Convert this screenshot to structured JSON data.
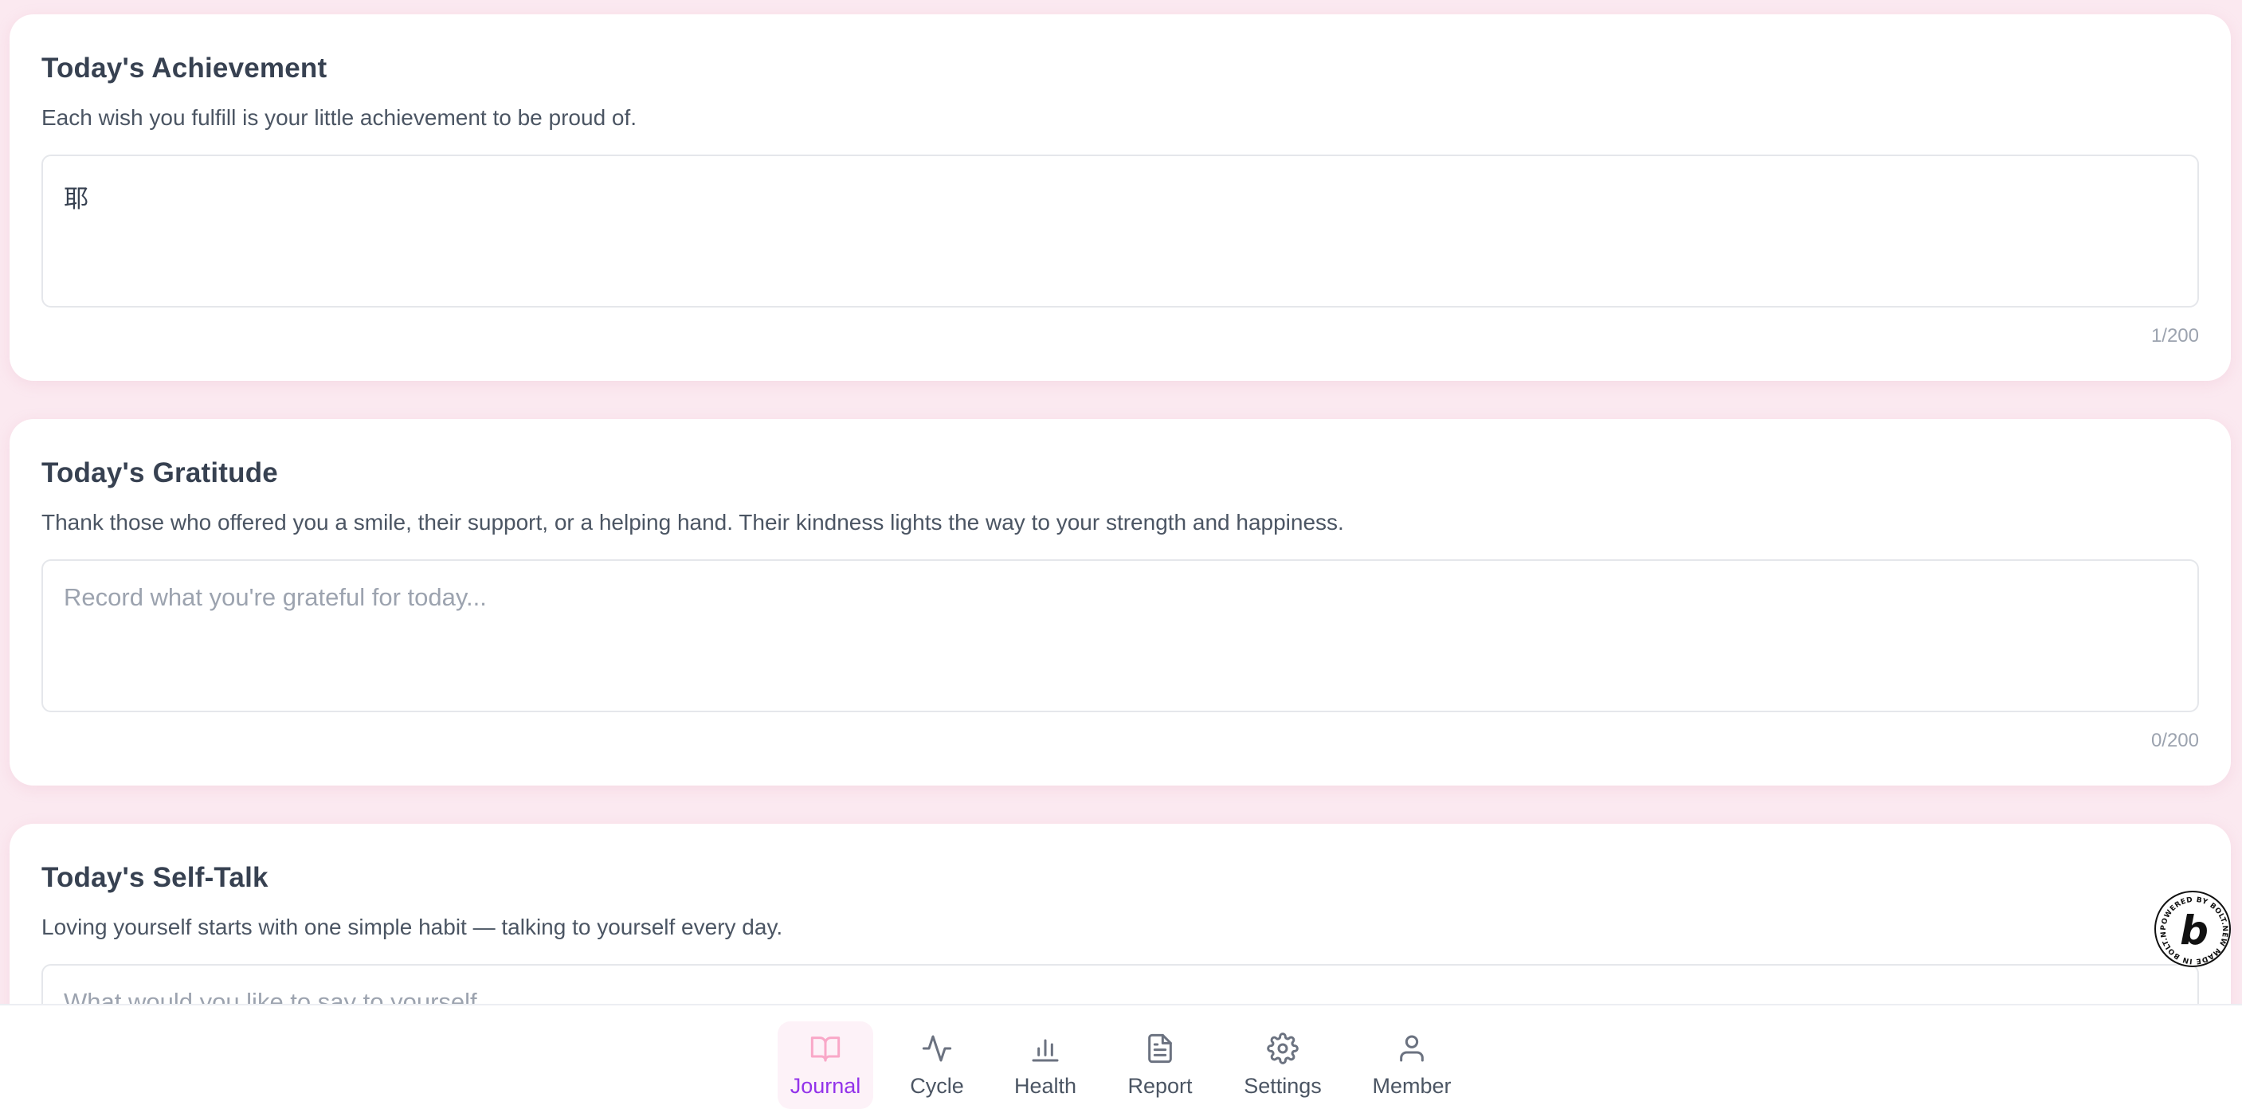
{
  "sections": [
    {
      "title": "Today's Achievement",
      "description": "Each wish you fulfill is your little achievement to be proud of.",
      "value": "耶",
      "placeholder": "",
      "counter": "1/200"
    },
    {
      "title": "Today's Gratitude",
      "description": "Thank those who offered you a smile, their support, or a helping hand. Their kindness lights the way to your strength and happiness.",
      "value": "",
      "placeholder": "Record what you're grateful for today...",
      "counter": "0/200"
    },
    {
      "title": "Today's Self-Talk",
      "description": "Loving yourself starts with one simple habit — talking to yourself every day.",
      "value": "",
      "placeholder": "What would you like to say to yourself..."
    }
  ],
  "nav": {
    "items": [
      {
        "label": "Journal",
        "icon": "book-open-icon",
        "active": true
      },
      {
        "label": "Cycle",
        "icon": "activity-icon",
        "active": false
      },
      {
        "label": "Health",
        "icon": "bar-chart-icon",
        "active": false
      },
      {
        "label": "Report",
        "icon": "file-text-icon",
        "active": false
      },
      {
        "label": "Settings",
        "icon": "gear-icon",
        "active": false
      },
      {
        "label": "Member",
        "icon": "user-icon",
        "active": false
      }
    ]
  },
  "badge": {
    "letter": "b",
    "ring_text": "POWERED BY BOLT.NEW MADE IN BOLT.NEW"
  },
  "colors": {
    "background": "#fbe9f0",
    "active_nav_text": "#9333ea",
    "active_nav_icon": "#f9a8c8",
    "active_nav_bg": "#fdf2f8"
  }
}
